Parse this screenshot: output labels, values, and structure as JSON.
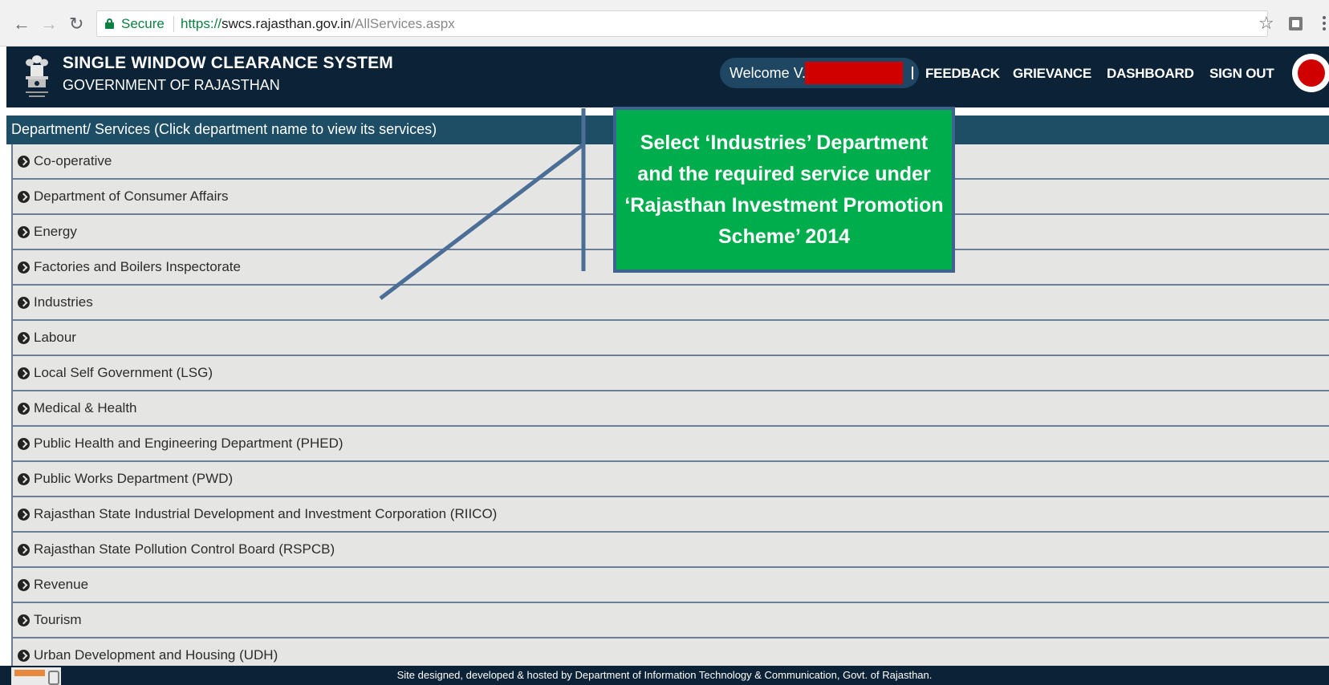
{
  "browser": {
    "secure_label": "Secure",
    "url_scheme": "https://",
    "url_host": "swcs.rajasthan.gov.in",
    "url_path": "/AllServices.aspx",
    "icons": [
      "back-arrow",
      "forward-arrow",
      "reload",
      "lock",
      "star",
      "extension",
      "menu"
    ]
  },
  "header": {
    "title": "SINGLE WINDOW CLEARANCE SYSTEM",
    "subtitle": "GOVERNMENT OF RAJASTHAN",
    "welcome": "Welcome V.",
    "nav": {
      "feedback": "FEEDBACK",
      "grievance": "GRIEVANCE",
      "dashboard": "DASHBOARD",
      "sign_out": "SIGN OUT"
    },
    "colors": {
      "bar": "#0c2236",
      "redaction": "#d10000"
    }
  },
  "departments": {
    "heading": "Department/ Services (Click department name to view its services)",
    "items": [
      "Co-operative",
      "Department of Consumer Affairs",
      "Energy",
      "Factories and Boilers Inspectorate",
      "Industries",
      "Labour",
      "Local Self Government (LSG)",
      "Medical & Health",
      "Public Health and Engineering Department (PHED)",
      "Public Works Department (PWD)",
      "Rajasthan State Industrial Development and Investment Corporation (RIICO)",
      "Rajasthan State Pollution Control Board (RSPCB)",
      "Revenue",
      "Tourism",
      "Urban Development and Housing (UDH)"
    ]
  },
  "annotation": {
    "text": "Select ‘Industries’ Department and the required service under ‘Rajasthan Investment Promotion Scheme’ 2014",
    "color": "#00ad4d"
  },
  "footer": {
    "text": "Site designed, developed & hosted by Department of Information Technology & Communication, Govt. of Rajasthan."
  }
}
